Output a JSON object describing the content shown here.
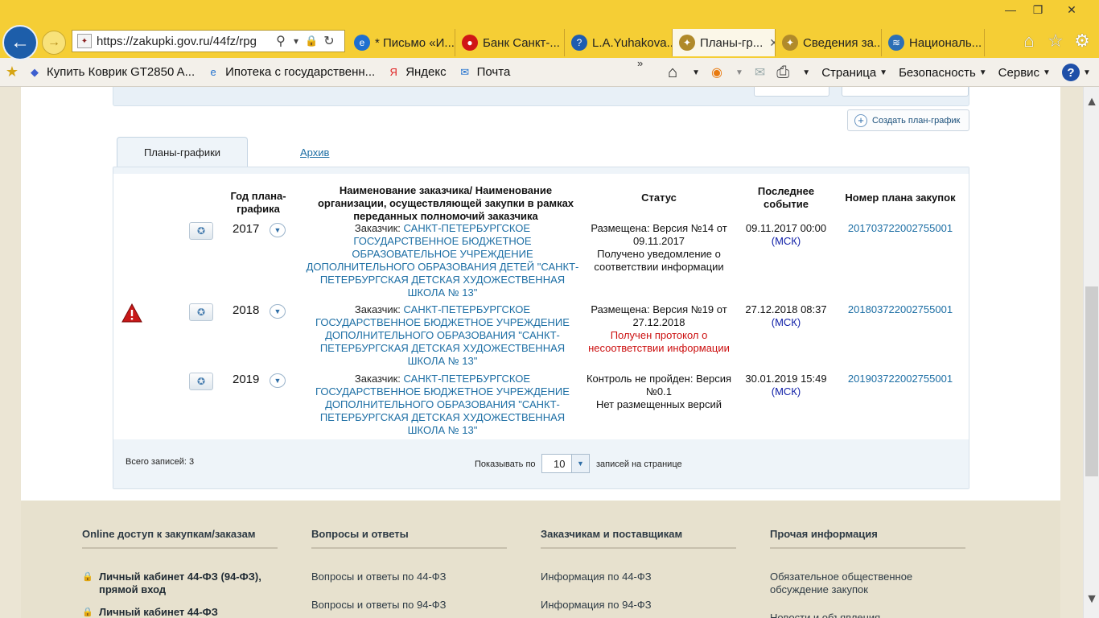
{
  "browser": {
    "window_controls": {
      "minimize": "—",
      "maximize": "❐",
      "close": "✕"
    },
    "back_icon": "←",
    "forward_icon": "→",
    "address": {
      "url": "https://zakupki.gov.ru/44fz/rpg",
      "search_icon": "⚲",
      "dropdown_icon": "▾",
      "lock_icon": "🔒",
      "refresh_icon": "↻"
    },
    "tabs": [
      {
        "title": "* Письмо «И...",
        "icon": "e",
        "color": "#1e6fcf"
      },
      {
        "title": "Банк Санкт-...",
        "icon": "●",
        "color": "#d01616"
      },
      {
        "title": "L.A.Yuhakova...",
        "icon": "?",
        "color": "#1e5cb0"
      },
      {
        "title": "Планы-гр...",
        "icon": "✦",
        "color": "#b08a2a",
        "active": true,
        "close": "✕"
      },
      {
        "title": "Сведения за...",
        "icon": "✦",
        "color": "#b08a2a"
      },
      {
        "title": "Националь...",
        "icon": "≋",
        "color": "#2c6fb6"
      }
    ],
    "right_icons": {
      "home": "⌂",
      "favorites": "☆",
      "settings": "⚙"
    },
    "favorites": [
      {
        "label": "Купить Коврик GT2850 A...",
        "icon": "◆",
        "color": "#3d5fcf"
      },
      {
        "label": "Ипотека с государственн...",
        "icon": "e",
        "color": "#1e6fcf"
      },
      {
        "label": "Яндекс",
        "icon": "Я",
        "color": "#e02020"
      },
      {
        "label": "Почта",
        "icon": "✉",
        "color": "#1e6fcf"
      }
    ],
    "more_icon": "»",
    "command_bar": {
      "home_icon": "⌂",
      "rss_icon": "◉",
      "mail_icon": "✉",
      "print_icon": "⎙",
      "page": "Страница",
      "safety": "Безопасность",
      "tools": "Сервис",
      "help_icon": "?",
      "arrow": "▼"
    }
  },
  "page": {
    "create_button": "Создать план-график",
    "create_icon": "+",
    "tabs": {
      "plans": "Планы-графики",
      "archive": "Архив"
    },
    "table": {
      "headers": {
        "year": "Год плана-графика",
        "customer": "Наименование заказчика/ Наименование организации, осуществляющей закупки в рамках переданных полномочий заказчика",
        "status": "Статус",
        "last_event": "Последнее событие",
        "plan_number": "Номер плана закупок"
      },
      "rows": [
        {
          "year": "2017",
          "customer_prefix": "Заказчик: ",
          "customer_name": "САНКТ-ПЕТЕРБУРГСКОЕ ГОСУДАРСТВЕННОЕ БЮДЖЕТНОЕ ОБРАЗОВАТЕЛЬНОЕ УЧРЕЖДЕНИЕ ДОПОЛНИТЕЛЬНОГО ОБРАЗОВАНИЯ ДЕТЕЙ \"САНКТ-ПЕТЕРБУРГСКАЯ ДЕТСКАЯ ХУДОЖЕСТВЕННАЯ ШКОЛА № 13\"",
          "status_main": "Размещена: Версия №14 от 09.11.2017",
          "status_note": "Получено уведомление о соответствии информации",
          "status_note_red": false,
          "event_time": "09.11.2017 00:00",
          "event_tz": "(МСК)",
          "plan_number": "201703722002755001",
          "warning": false
        },
        {
          "year": "2018",
          "customer_prefix": "Заказчик: ",
          "customer_name": "САНКТ-ПЕТЕРБУРГСКОЕ ГОСУДАРСТВЕННОЕ БЮДЖЕТНОЕ УЧРЕЖДЕНИЕ ДОПОЛНИТЕЛЬНОГО ОБРАЗОВАНИЯ \"САНКТ-ПЕТЕРБУРГСКАЯ ДЕТСКАЯ ХУДОЖЕСТВЕННАЯ ШКОЛА № 13\"",
          "status_main": "Размещена: Версия №19 от 27.12.2018",
          "status_note": "Получен протокол о несоответствии информации",
          "status_note_red": true,
          "event_time": "27.12.2018 08:37",
          "event_tz": "(МСК)",
          "plan_number": "201803722002755001",
          "warning": true
        },
        {
          "year": "2019",
          "customer_prefix": "Заказчик: ",
          "customer_name": "САНКТ-ПЕТЕРБУРГСКОЕ ГОСУДАРСТВЕННОЕ БЮДЖЕТНОЕ УЧРЕЖДЕНИЕ ДОПОЛНИТЕЛЬНОГО ОБРАЗОВАНИЯ \"САНКТ-ПЕТЕРБУРГСКАЯ ДЕТСКАЯ ХУДОЖЕСТВЕННАЯ ШКОЛА № 13\"",
          "status_main": "Контроль не пройден: Версия №0.1",
          "status_note": "Нет размещенных версий",
          "status_note_red": false,
          "event_time": "30.01.2019 15:49",
          "event_tz": "(МСК)",
          "plan_number": "201903722002755001",
          "warning": false
        }
      ],
      "row_icon": "✪",
      "dropdown_icon": "▼",
      "warning_icon": "!"
    },
    "pagination": {
      "total": "Всего записей: 3",
      "show_label": "Показывать по",
      "per_page_value": "10",
      "arrow": "▼",
      "per_page_suffix": "записей на странице"
    }
  },
  "footer": {
    "columns": [
      {
        "heading": "Online доступ к закупкам/заказам",
        "items": [
          {
            "label": "Личный кабинет 44-ФЗ (94-ФЗ), прямой вход",
            "bold": true
          },
          {
            "label": "Личный кабинет 44-ФЗ",
            "bold": true
          }
        ]
      },
      {
        "heading": "Вопросы и ответы",
        "items": [
          {
            "label": "Вопросы и ответы по 44-ФЗ"
          },
          {
            "label": "Вопросы и ответы по 94-ФЗ"
          }
        ]
      },
      {
        "heading": "Заказчикам и поставщикам",
        "items": [
          {
            "label": "Информация по 44-ФЗ"
          },
          {
            "label": "Информация по 94-ФЗ"
          }
        ]
      },
      {
        "heading": "Прочая информация",
        "items": [
          {
            "label": "Обязательное общественное обсуждение закупок"
          },
          {
            "label": "Новости и объявления"
          }
        ]
      }
    ],
    "lock_icon": "🔒"
  },
  "scrollbar": {
    "up": "▲",
    "down": "▼"
  }
}
